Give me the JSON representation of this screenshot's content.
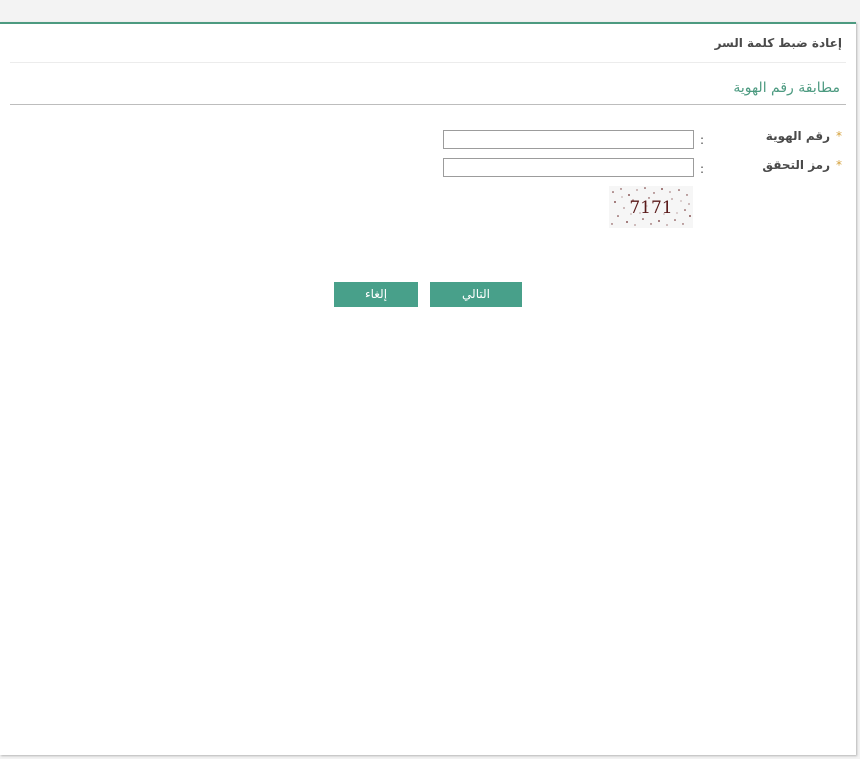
{
  "page": {
    "title": "إعادة ضبط كلمة السر",
    "section_title": "مطابقة رقم الهوية"
  },
  "form": {
    "required_marker": "*",
    "separator": ":",
    "fields": [
      {
        "label": "رقم الهوية",
        "value": ""
      },
      {
        "label": "رمز التحقق",
        "value": ""
      }
    ],
    "captcha_text": "7171"
  },
  "actions": {
    "next_label": "التالي",
    "cancel_label": "إلغاء"
  },
  "colors": {
    "accent": "#4c9a80",
    "button": "#48a08a",
    "required": "#d4a03a",
    "captcha_text": "#5a1a1a"
  }
}
